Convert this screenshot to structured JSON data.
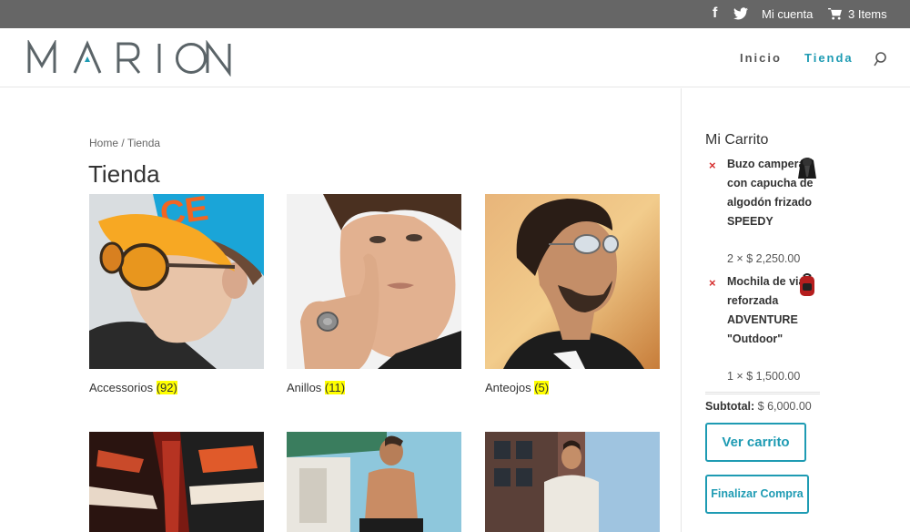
{
  "topbar": {
    "facebook_icon": "facebook-icon",
    "twitter_icon": "twitter-icon",
    "account_label": "Mi cuenta",
    "cart_icon": "cart-icon",
    "cart_items_label": "3 Items"
  },
  "header": {
    "logo_text": "MARION",
    "nav": [
      {
        "label": "Inicio",
        "active": false
      },
      {
        "label": "Tienda",
        "active": true
      }
    ],
    "search_icon": "search-icon",
    "accent_color": "#1e9bb3"
  },
  "main": {
    "breadcrumb": {
      "home": "Home",
      "separator": "/",
      "current": "Tienda"
    },
    "title": "Tienda",
    "categories": [
      {
        "name": "Accessorios",
        "count": "(92)"
      },
      {
        "name": "Anillos",
        "count": "(11)"
      },
      {
        "name": "Anteojos",
        "count": "(5)"
      },
      {
        "name": "",
        "count": ""
      },
      {
        "name": "",
        "count": ""
      },
      {
        "name": "",
        "count": ""
      }
    ]
  },
  "sidebar": {
    "title": "Mi Carrito",
    "items": [
      {
        "remove": "×",
        "name": "Buzo campera con capucha de algodón frizado SPEEDY",
        "qty_price": "2 × $ 2,250.00"
      },
      {
        "remove": "×",
        "name": "Mochila de viaje reforzada ADVENTURE \"Outdoor\"",
        "qty_price": "1 × $ 1,500.00"
      }
    ],
    "subtotal_label": "Subtotal:",
    "subtotal_value": "$ 6,000.00",
    "view_cart": "Ver carrito",
    "checkout": "Finalizar Compra"
  }
}
